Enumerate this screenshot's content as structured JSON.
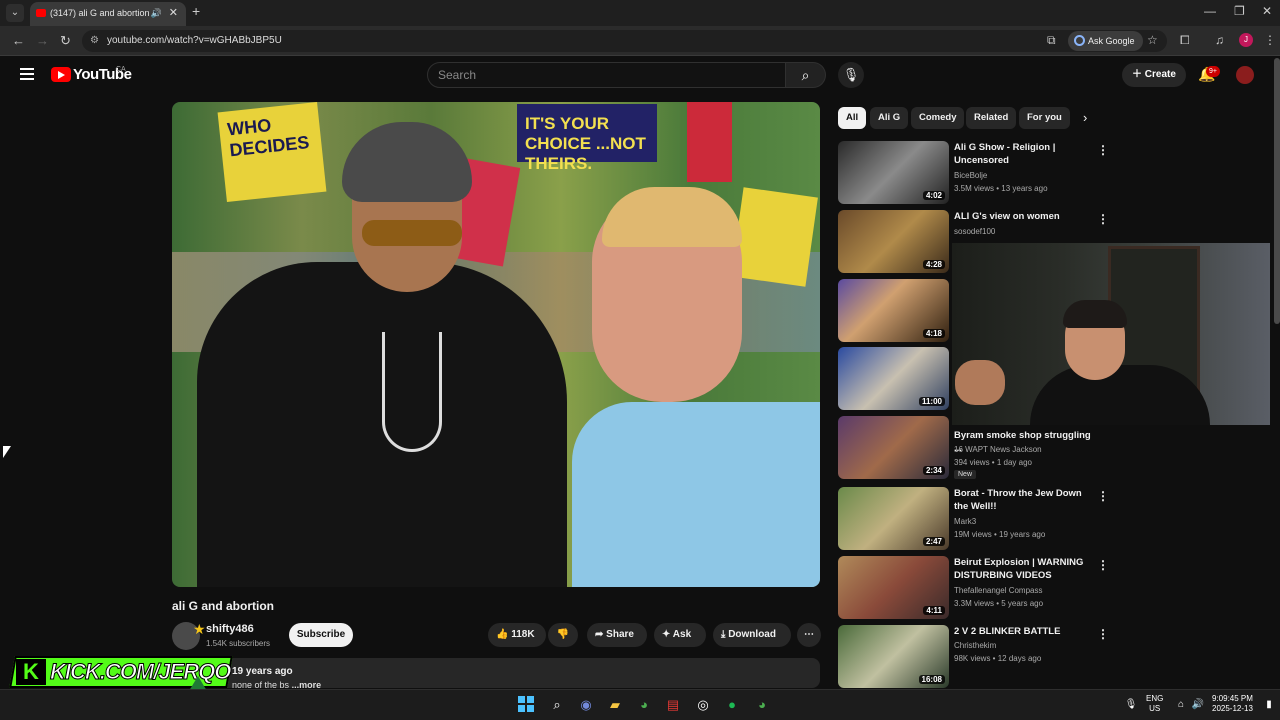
{
  "browser": {
    "tab_title": "(3147) ali G and abortion -",
    "url": "youtube.com/watch?v=wGHABbJBP5U",
    "ask_google": "Ask Google",
    "profile_letter": "J"
  },
  "youtube": {
    "logo_text": "YouTube",
    "region": "CA",
    "search_placeholder": "Search",
    "create_label": "Create",
    "notifications_badge": "9+"
  },
  "video": {
    "title": "ali G and abortion",
    "sign_left": "WHO DECIDES",
    "sign_right": "IT'S YOUR CHOICE ...NOT THEIRS.",
    "channel": "shifty486",
    "subscribers": "1.54K subscribers",
    "subscribe_label": "Subscribe",
    "likes": "118K",
    "share_label": "Share",
    "ask_label": "Ask",
    "download_label": "Download",
    "upload_age": "19 years ago",
    "description_snippet": "none of the bs",
    "more_label": "...more"
  },
  "overlay": {
    "kick_text": "KICK.COM/JERQO"
  },
  "chips": [
    {
      "label": "All",
      "active": true
    },
    {
      "label": "Ali G",
      "active": false
    },
    {
      "label": "Comedy",
      "active": false
    },
    {
      "label": "Related",
      "active": false
    },
    {
      "label": "For you",
      "active": false
    }
  ],
  "recommendations": [
    {
      "title": "Ali G Show - Religion | Uncensored",
      "channel": "BiceBolje",
      "meta": "3.5M views • 13 years ago",
      "duration": "4:02"
    },
    {
      "title": "ALI G's view on women",
      "channel": "sosodef100",
      "meta": "",
      "duration": "4:28"
    },
    {
      "title": "",
      "channel": "",
      "meta": "",
      "duration": "4:18"
    },
    {
      "title": "",
      "channel": "",
      "meta": "",
      "duration": "11:00"
    },
    {
      "title": "Byram smoke shop struggling ...",
      "channel": "16 WAPT News Jackson",
      "meta": "394 views • 1 day ago",
      "duration": "2:34",
      "badge": "New"
    },
    {
      "title": "Borat - Throw the Jew Down the Well!!",
      "channel": "Mark3",
      "meta": "19M views • 19 years ago",
      "duration": "2:47"
    },
    {
      "title": "Beirut Explosion | WARNING DISTURBING VIDEOS",
      "channel": "Thefallenangel Compass",
      "meta": "3.3M views • 5 years ago",
      "duration": "4:11"
    },
    {
      "title": "2 V 2 BLINKER BATTLE",
      "channel": "Christhekim",
      "meta": "98K views • 12 days ago",
      "duration": "16:08"
    }
  ],
  "taskbar": {
    "lang_top": "ENG",
    "lang_bottom": "US",
    "time": "9:09:45 PM",
    "date": "2025-12-13"
  },
  "colors": {
    "youtube_red": "#ff0000",
    "kick_green": "#53fc18",
    "background": "#0f0f0f"
  }
}
